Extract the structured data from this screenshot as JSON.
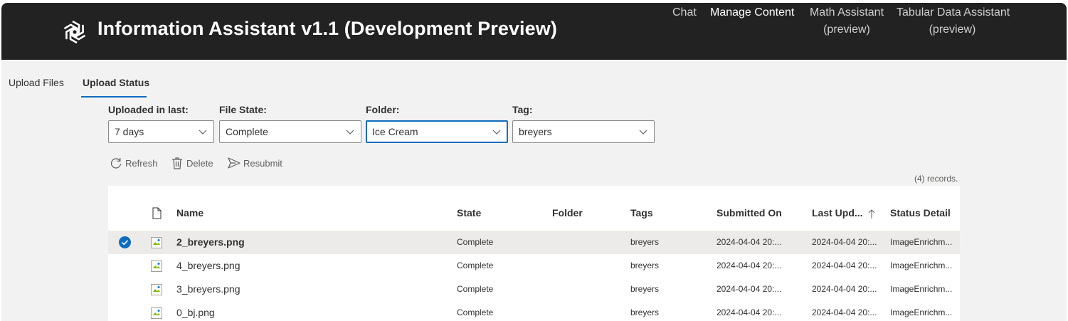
{
  "header": {
    "title": "Information Assistant v1.1 (Development Preview)",
    "nav": [
      {
        "label": "Chat"
      },
      {
        "label": "Manage Content"
      },
      {
        "label": "Math Assistant",
        "sub": "(preview)"
      },
      {
        "label": "Tabular Data Assistant",
        "sub": "(preview)"
      }
    ]
  },
  "tabs": [
    {
      "label": "Upload Files"
    },
    {
      "label": "Upload Status"
    }
  ],
  "filters": {
    "uploaded": {
      "label": "Uploaded in last:",
      "value": "7 days"
    },
    "file_state": {
      "label": "File State:",
      "value": "Complete"
    },
    "folder": {
      "label": "Folder:",
      "value": "Ice Cream"
    },
    "tag": {
      "label": "Tag:",
      "value": "breyers"
    }
  },
  "commands": {
    "refresh": "Refresh",
    "delete": "Delete",
    "resubmit": "Resubmit"
  },
  "records_text": "(4) records.",
  "table": {
    "columns": {
      "name": "Name",
      "state": "State",
      "folder": "Folder",
      "tags": "Tags",
      "submitted": "Submitted On",
      "updated": "Last Upd...",
      "status": "Status Detail"
    },
    "rows": [
      {
        "name": "2_breyers.png",
        "state": "Complete",
        "folder": "",
        "tags": "breyers",
        "submitted": "2024-04-04 20:...",
        "updated": "2024-04-04 20:...",
        "status": "ImageEnrichm..."
      },
      {
        "name": "4_breyers.png",
        "state": "Complete",
        "folder": "",
        "tags": "breyers",
        "submitted": "2024-04-04 20:...",
        "updated": "2024-04-04 20:...",
        "status": "ImageEnrichm..."
      },
      {
        "name": "3_breyers.png",
        "state": "Complete",
        "folder": "",
        "tags": "breyers",
        "submitted": "2024-04-04 20:...",
        "updated": "2024-04-04 20:...",
        "status": "ImageEnrichm..."
      },
      {
        "name": "0_bj.png",
        "state": "Complete",
        "folder": "",
        "tags": "breyers",
        "submitted": "2024-04-04 20:...",
        "updated": "2024-04-04 20:...",
        "status": "ImageEnrichm..."
      }
    ]
  }
}
